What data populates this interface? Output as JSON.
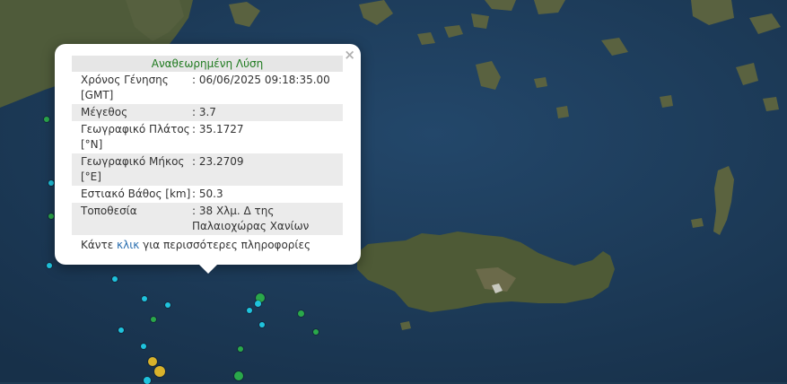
{
  "popup": {
    "title": "Αναθεωρημένη Λύση",
    "close_icon": "×",
    "rows": [
      {
        "label": "Χρόνος Γένησης [GMT]",
        "value": ": 06/06/2025 09:18:35.00"
      },
      {
        "label": "Μέγεθος",
        "value": ": 3.7"
      },
      {
        "label": "Γεωγραφικό Πλάτος [°N]",
        "value": ": 35.1727"
      },
      {
        "label": "Γεωγραφικό Μήκος [°E]",
        "value": ": 23.2709"
      },
      {
        "label": "Εστιακό Βάθος [km]",
        "value": ": 50.3"
      },
      {
        "label": "Τοποθεσία",
        "value": ": 38 Χλμ. Δ της Παλαιοχώρας Χανίων"
      }
    ],
    "more_prefix": "Κάντε ",
    "more_link": "κλικ",
    "more_suffix": " για περισσότερες πληροφορίες"
  },
  "colors": {
    "sea": "#1d3a52",
    "land": "#4d5a38",
    "marker_cyan": "#1fc3dd",
    "marker_green": "#2aa84a",
    "marker_yellow": "#d8b22b",
    "title_green": "#1f7a1f",
    "link_blue": "#2a6fb0"
  }
}
